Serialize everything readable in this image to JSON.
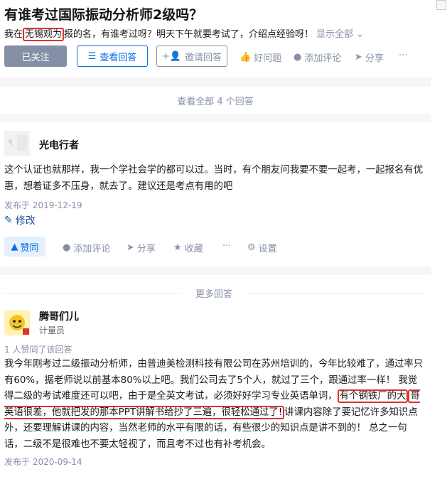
{
  "question": {
    "title": "有谁考过国际振动分析师2级吗？",
    "desc_before": "我在",
    "desc_highlight": "无锡观为",
    "desc_after": "报的名，有谁考过呀？明天下午就要考试了，介绍点经验呀！",
    "show_all": "显示全部 ⌄",
    "actions": {
      "followed": "已关注",
      "view_answers": "查看回答",
      "invite": "邀请回答",
      "good_question": "好问题",
      "add_comment": "添加评论",
      "share": "分享",
      "more": "···"
    }
  },
  "view_all_answers": "查看全部 4 个回答",
  "answer1": {
    "author": "光电行者",
    "content": "这个认证也就那样，我一个学社会学的都可以过。当时，有个朋友问我要不要一起考，一起报名有优惠，想着证多不压身，就去了。建议还是考点有用的吧",
    "date": "发布于 2019-12-19",
    "edit": "修改",
    "actions": {
      "vote": "赞同",
      "add_comment": "添加评论",
      "share": "分享",
      "collect": "收藏",
      "more": "···",
      "settings": "设置"
    }
  },
  "more_answers": "更多回答",
  "answer2": {
    "author": "腾哥们儿",
    "badge": "计量员",
    "likes": "1 人赞同了该回答",
    "content_a": "我今年刚考过二级振动分析师，由普迪美检测科技有限公司在苏州培训的，今年比较难了，通过率只有60%，据老师说以前基本80%以上吧。我们公司去了5个人，就过了三个，跟通过率一样！ 我觉得二级的考试难度还可以吧，由于是全英文考试，必须好好学习专业英语单词，",
    "content_hl1": "有个钢铁厂的大",
    "content_hl2": "哥英语很差，他就把发的那本PPT讲解书给抄了三遍，很轻松通过了!",
    "content_b": "讲课内容除了要记忆许多知识点外，还要理解讲课的内容，当然老师的水平有限的话，有些很少的知识点是讲不到的！ 总之一句话，二级不是很难也不要太轻视了，而且考不过也有补考机会。",
    "date": "发布于 2020-09-14"
  }
}
